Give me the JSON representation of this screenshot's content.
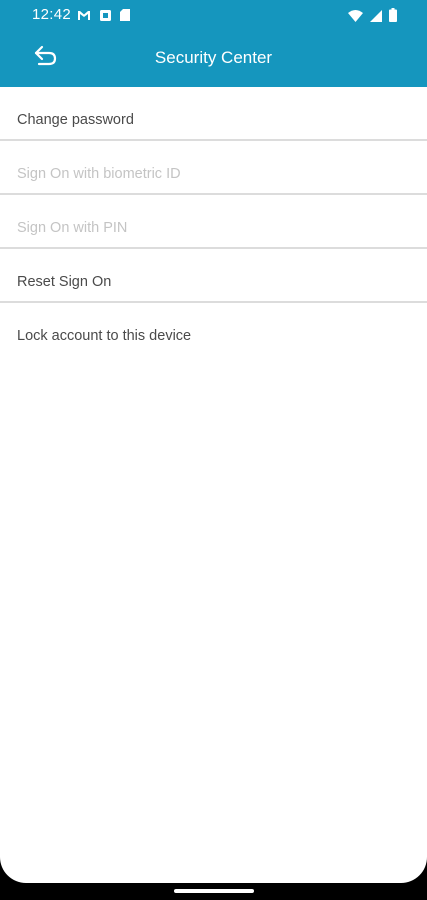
{
  "status_bar": {
    "time": "12:42",
    "left_icons": [
      "gmail-icon",
      "notification-square-icon",
      "sim-card-icon"
    ],
    "right_icons": [
      "wifi-icon",
      "cellular-signal-icon",
      "battery-icon"
    ]
  },
  "app_bar": {
    "title": "Security Center",
    "back_icon": "back-arrow-icon"
  },
  "menu": {
    "items": [
      {
        "label": "Change password",
        "enabled": true
      },
      {
        "label": "Sign On with biometric ID",
        "enabled": false
      },
      {
        "label": "Sign On with PIN",
        "enabled": false
      },
      {
        "label": "Reset Sign On",
        "enabled": true
      },
      {
        "label": "Lock account to this device",
        "enabled": true
      }
    ]
  },
  "colors": {
    "primary": "#1596be",
    "text": "#4a4a4a",
    "text_disabled": "#c4c4c4",
    "divider": "#dcdcdc"
  }
}
